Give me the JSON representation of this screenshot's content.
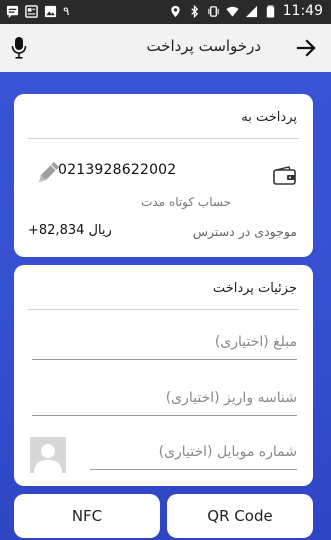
{
  "status_bar": {
    "time": "11:49",
    "left_icons": [
      "message-icon",
      "news-icon",
      "image-icon",
      "number-9-icon"
    ],
    "right_icons": [
      "location-icon",
      "bluetooth-icon",
      "vibrate-icon",
      "wifi-icon",
      "signal-icon",
      "battery-icon"
    ],
    "left_number": "۹"
  },
  "app_bar": {
    "title": "درخواست پرداخت"
  },
  "pay_to": {
    "title": "پرداخت به",
    "account_number": "0213928622002",
    "account_type": "حساب کوتاه مدت",
    "balance_label": "موجودی در دسترس",
    "balance_value": "+82,834 ریال"
  },
  "details": {
    "title": "جزئیات پرداخت",
    "amount_placeholder": "مبلغ (اختیاری)",
    "deposit_id_placeholder": "شناسه واریز (اختیاری)",
    "mobile_placeholder": "شماره موبایل (اختیاری)"
  },
  "buttons": {
    "nfc": "NFC",
    "qr": "QR Code"
  },
  "colors": {
    "background": "#3550d0",
    "status_bar": "#2a2a2a",
    "app_bar": "#f2f2f2",
    "card": "#ffffff"
  }
}
